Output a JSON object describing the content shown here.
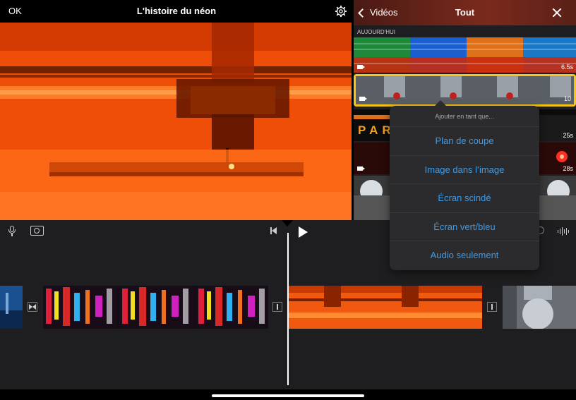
{
  "topbar": {
    "ok_label": "OK",
    "title": "L'histoire du néon"
  },
  "browser": {
    "back_label": "Vidéos",
    "title": "Tout",
    "section_label": "AUJOURD'HUI",
    "clips": [
      {
        "duration": "6.5s"
      },
      {
        "duration": "10"
      },
      {
        "duration": "25s"
      },
      {
        "duration": "28s"
      },
      {
        "duration": ""
      }
    ],
    "clip_partial_text": "PAR"
  },
  "popover": {
    "header": "Ajouter en tant que...",
    "items": [
      {
        "label": "Plan de coupe"
      },
      {
        "label": "Image dans l’image"
      },
      {
        "label": "Écran scindé"
      },
      {
        "label": "Écran vert/bleu"
      },
      {
        "label": "Audio seulement"
      }
    ]
  },
  "colors": {
    "accent": "#3f9be6",
    "selection": "#f5c518",
    "panel": "#1e1e20"
  },
  "icons": [
    "settings-icon",
    "chevron-left-icon",
    "close-icon",
    "microphone-icon",
    "camera-icon",
    "skip-back-icon",
    "play-icon",
    "audio-waveform-icon",
    "transition-icon"
  ]
}
